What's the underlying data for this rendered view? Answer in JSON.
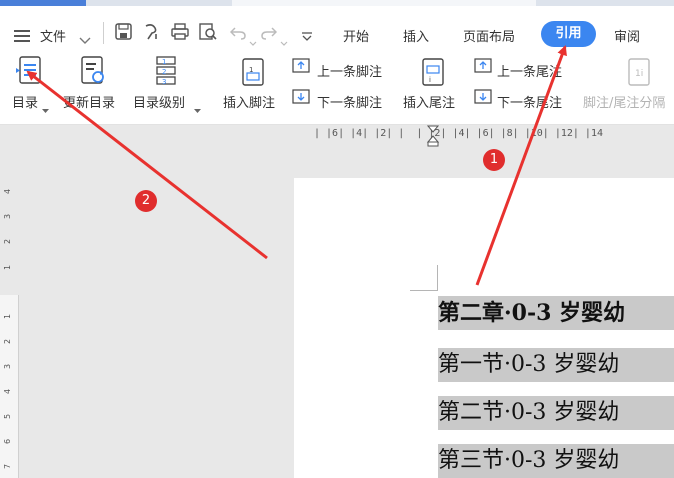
{
  "menu": {
    "file_label": "文件",
    "tabs": [
      "开始",
      "插入",
      "页面布局",
      "引用",
      "审阅"
    ],
    "active_tab": "引用"
  },
  "ribbon": {
    "toc": "目录",
    "update_toc": "更新目录",
    "toc_level": "目录级别",
    "insert_footnote": "插入脚注",
    "prev_footnote": "上一条脚注",
    "next_footnote": "下一条脚注",
    "insert_endnote": "插入尾注",
    "prev_endnote": "上一条尾注",
    "next_endnote": "下一条尾注",
    "footnote_separator": "脚注/尾注分隔"
  },
  "ruler": {
    "horizontal": "| |6| |4| |2| |  | |2| |4| |6| |8| |10| |12| |14",
    "vertical": [
      "4",
      "3",
      "2",
      "1",
      "1",
      "2",
      "3",
      "4",
      "5",
      "6",
      "7"
    ]
  },
  "document": {
    "lines": [
      "第二章·0-3 岁婴幼",
      "第一节·0-3 岁婴幼",
      "第二节·0-3 岁婴幼",
      "第三节·0-3 岁婴幼"
    ]
  },
  "annotations": {
    "step1": "1",
    "step2": "2",
    "arrow_color": "#e8322f"
  }
}
